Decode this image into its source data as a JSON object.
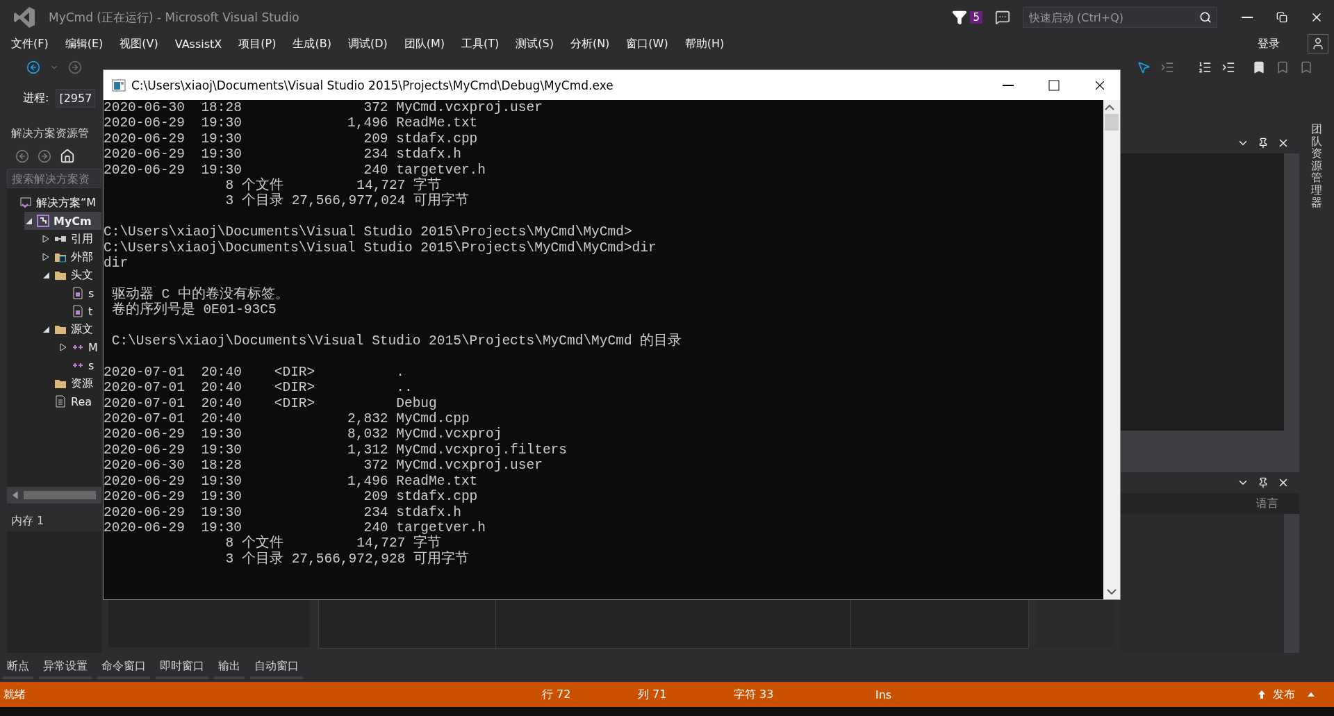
{
  "title_bar": {
    "title": "MyCmd (正在运行) - Microsoft Visual Studio",
    "notification_count": "5",
    "quick_launch": {
      "placeholder": "快速启动 (Ctrl+Q)"
    }
  },
  "menu": [
    "文件(F)",
    "编辑(E)",
    "视图(V)",
    "VAssistX",
    "项目(P)",
    "生成(B)",
    "调试(D)",
    "团队(M)",
    "工具(T)",
    "测试(S)",
    "分析(N)",
    "窗口(W)",
    "帮助(H)"
  ],
  "sign_in": "登录",
  "process": {
    "label": "进程:",
    "value": "[2957"
  },
  "solution_explorer": {
    "title": "解决方案资源管",
    "search": {
      "placeholder": "搜索解决方案资"
    },
    "tree": [
      {
        "kind": "solution",
        "label": "解决方案“M",
        "selected": false,
        "children": [
          {
            "kind": "project",
            "label": "MyCm",
            "selected": true,
            "expanded": true,
            "children": [
              {
                "kind": "references",
                "label": "引用",
                "selected": false,
                "expanded": false
              },
              {
                "kind": "external",
                "label": "外部",
                "selected": false,
                "expanded": false
              },
              {
                "kind": "folder",
                "label": "头文",
                "selected": false,
                "expanded": true,
                "children": [
                  {
                    "kind": "header",
                    "label": "s",
                    "selected": false
                  },
                  {
                    "kind": "header",
                    "label": "t",
                    "selected": false
                  }
                ]
              },
              {
                "kind": "folder",
                "label": "源文",
                "selected": false,
                "expanded": true,
                "children": [
                  {
                    "kind": "cpp",
                    "label": "M",
                    "selected": false,
                    "expanded": false
                  },
                  {
                    "kind": "cpp",
                    "label": "s",
                    "selected": false
                  }
                ]
              },
              {
                "kind": "folder",
                "label": "资源",
                "selected": false
              },
              {
                "kind": "file",
                "label": "Rea",
                "selected": false
              }
            ]
          }
        ]
      }
    ]
  },
  "memory_panel": {
    "title": "内存 1"
  },
  "right_panel": {
    "column": "语言",
    "side_tab": "团队资源管理器"
  },
  "bottom_tabs": [
    "断点",
    "异常设置",
    "命令窗口",
    "即时窗口",
    "输出",
    "自动窗口"
  ],
  "status_bar": [
    "就绪",
    "行 72",
    "列 71",
    "字符 33",
    "Ins",
    "发布"
  ],
  "console": {
    "title": "C:\\Users\\xiaoj\\Documents\\Visual Studio 2015\\Projects\\MyCmd\\Debug\\MyCmd.exe",
    "lines": [
      {
        "text": "2020-06-30  18:28               372 MyCmd.vcxproj.user",
        "blank_before": false
      },
      {
        "text": "2020-06-29  19:30             1,496 ReadMe.txt",
        "blank_before": false
      },
      {
        "text": "2020-06-29  19:30               209 stdafx.cpp",
        "blank_before": false
      },
      {
        "text": "2020-06-29  19:30               234 stdafx.h",
        "blank_before": false
      },
      {
        "text": "2020-06-29  19:30               240 targetver.h",
        "blank_before": false
      },
      {
        "text": "               8 个文件         14,727 字节",
        "blank_before": false
      },
      {
        "text": "               3 个目录 27,566,977,024 可用字节",
        "blank_before": false
      },
      {
        "text": "C:\\Users\\xiaoj\\Documents\\Visual Studio 2015\\Projects\\MyCmd\\MyCmd>",
        "blank_before": true
      },
      {
        "text": "C:\\Users\\xiaoj\\Documents\\Visual Studio 2015\\Projects\\MyCmd\\MyCmd>dir",
        "blank_before": false
      },
      {
        "text": "dir",
        "blank_before": false
      },
      {
        "text": " 驱动器 C 中的卷没有标签。",
        "blank_before": true
      },
      {
        "text": " 卷的序列号是 0E01-93C5",
        "blank_before": false
      },
      {
        "text": " C:\\Users\\xiaoj\\Documents\\Visual Studio 2015\\Projects\\MyCmd\\MyCmd 的目录",
        "blank_before": true
      },
      {
        "text": "2020-07-01  20:40    <DIR>          .",
        "blank_before": true
      },
      {
        "text": "2020-07-01  20:40    <DIR>          ..",
        "blank_before": false
      },
      {
        "text": "2020-07-01  20:40    <DIR>          Debug",
        "blank_before": false
      },
      {
        "text": "2020-07-01  20:40             2,832 MyCmd.cpp",
        "blank_before": false
      },
      {
        "text": "2020-06-29  19:30             8,032 MyCmd.vcxproj",
        "blank_before": false
      },
      {
        "text": "2020-06-29  19:30             1,312 MyCmd.vcxproj.filters",
        "blank_before": false
      },
      {
        "text": "2020-06-30  18:28               372 MyCmd.vcxproj.user",
        "blank_before": false
      },
      {
        "text": "2020-06-29  19:30             1,496 ReadMe.txt",
        "blank_before": false
      },
      {
        "text": "2020-06-29  19:30               209 stdafx.cpp",
        "blank_before": false
      },
      {
        "text": "2020-06-29  19:30               234 stdafx.h",
        "blank_before": false
      },
      {
        "text": "2020-06-29  19:30               240 targetver.h",
        "blank_before": false
      },
      {
        "text": "               8 个文件         14,727 字节",
        "blank_before": false
      },
      {
        "text": "               3 个目录 27,566,972,928 可用字节",
        "blank_before": false
      }
    ]
  }
}
